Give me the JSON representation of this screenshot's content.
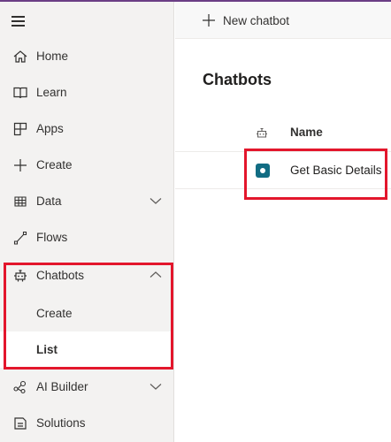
{
  "sidebar": {
    "items": [
      {
        "label": "Home",
        "icon": "home-icon"
      },
      {
        "label": "Learn",
        "icon": "book-icon"
      },
      {
        "label": "Apps",
        "icon": "apps-icon"
      },
      {
        "label": "Create",
        "icon": "plus-icon"
      },
      {
        "label": "Data",
        "icon": "table-icon",
        "expandable": true,
        "expanded": false
      },
      {
        "label": "Flows",
        "icon": "flow-icon"
      },
      {
        "label": "Chatbots",
        "icon": "bot-icon",
        "expandable": true,
        "expanded": true
      },
      {
        "label": "Create",
        "sub": true
      },
      {
        "label": "List",
        "sub": true,
        "active": true
      },
      {
        "label": "AI Builder",
        "icon": "ai-builder-icon",
        "expandable": true,
        "expanded": false
      },
      {
        "label": "Solutions",
        "icon": "solutions-icon"
      }
    ]
  },
  "toolbar": {
    "new_label": "New chatbot"
  },
  "main": {
    "title": "Chatbots",
    "columns": {
      "name": "Name"
    },
    "rows": [
      {
        "name": "Get Basic Details"
      }
    ]
  },
  "colors": {
    "accent": "#6b3e85",
    "bot_tile": "#116c83",
    "highlight": "#e3162c"
  }
}
